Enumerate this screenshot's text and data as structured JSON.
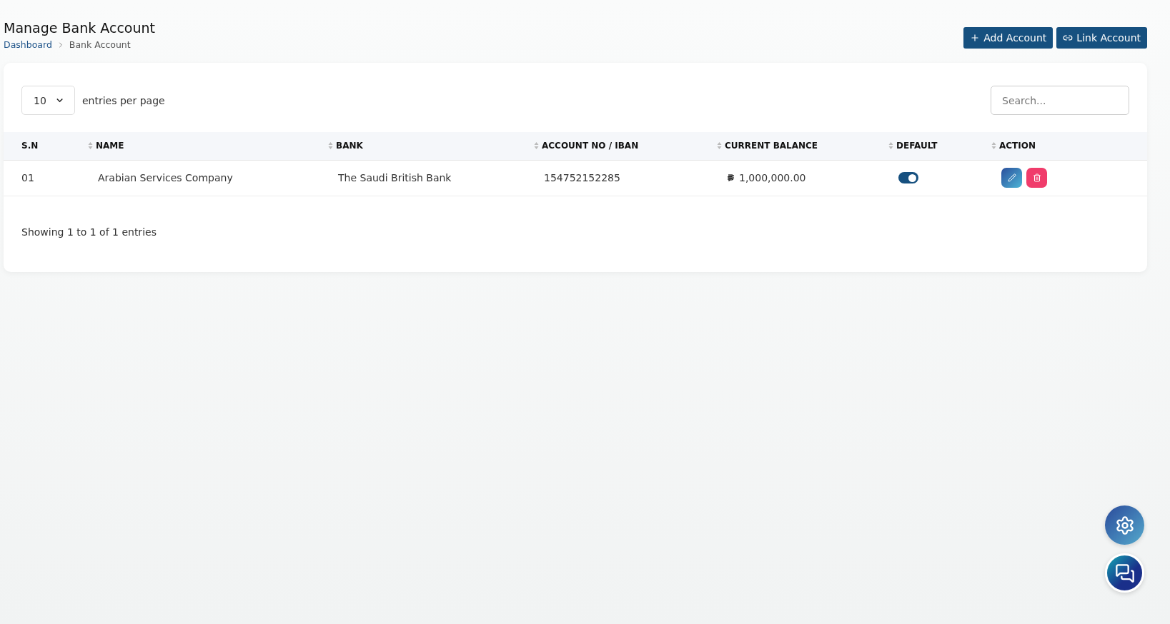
{
  "page": {
    "title": "Manage Bank Account",
    "breadcrumb": [
      {
        "label": "Dashboard",
        "link": true
      },
      {
        "label": "Bank Account",
        "link": false
      }
    ]
  },
  "actions": [
    {
      "label": "Add Account",
      "kind": "add"
    },
    {
      "label": "Link Account",
      "kind": "link"
    }
  ],
  "table_controls": {
    "page_size": "10",
    "page_size_label": "entries per page",
    "search": {
      "placeholder": "Search..."
    }
  },
  "table": {
    "columns": [
      {
        "label": "S.N",
        "sortable": false
      },
      {
        "label": "NAME",
        "sortable": true
      },
      {
        "label": "BANK",
        "sortable": true
      },
      {
        "label": "ACCOUNT NO / IBAN",
        "sortable": true
      },
      {
        "label": "CURRENT BALANCE",
        "sortable": true
      },
      {
        "label": "DEFAULT",
        "sortable": true
      },
      {
        "label": "ACTION",
        "sortable": true
      }
    ],
    "rows": [
      {
        "sn": "01",
        "name": "Arabian Services Company",
        "bank": "The Saudi British Bank",
        "account": "154752152285",
        "balance": "1,000,000.00",
        "default": true
      }
    ]
  },
  "footer": "Showing 1 to 1 of 1 entries"
}
